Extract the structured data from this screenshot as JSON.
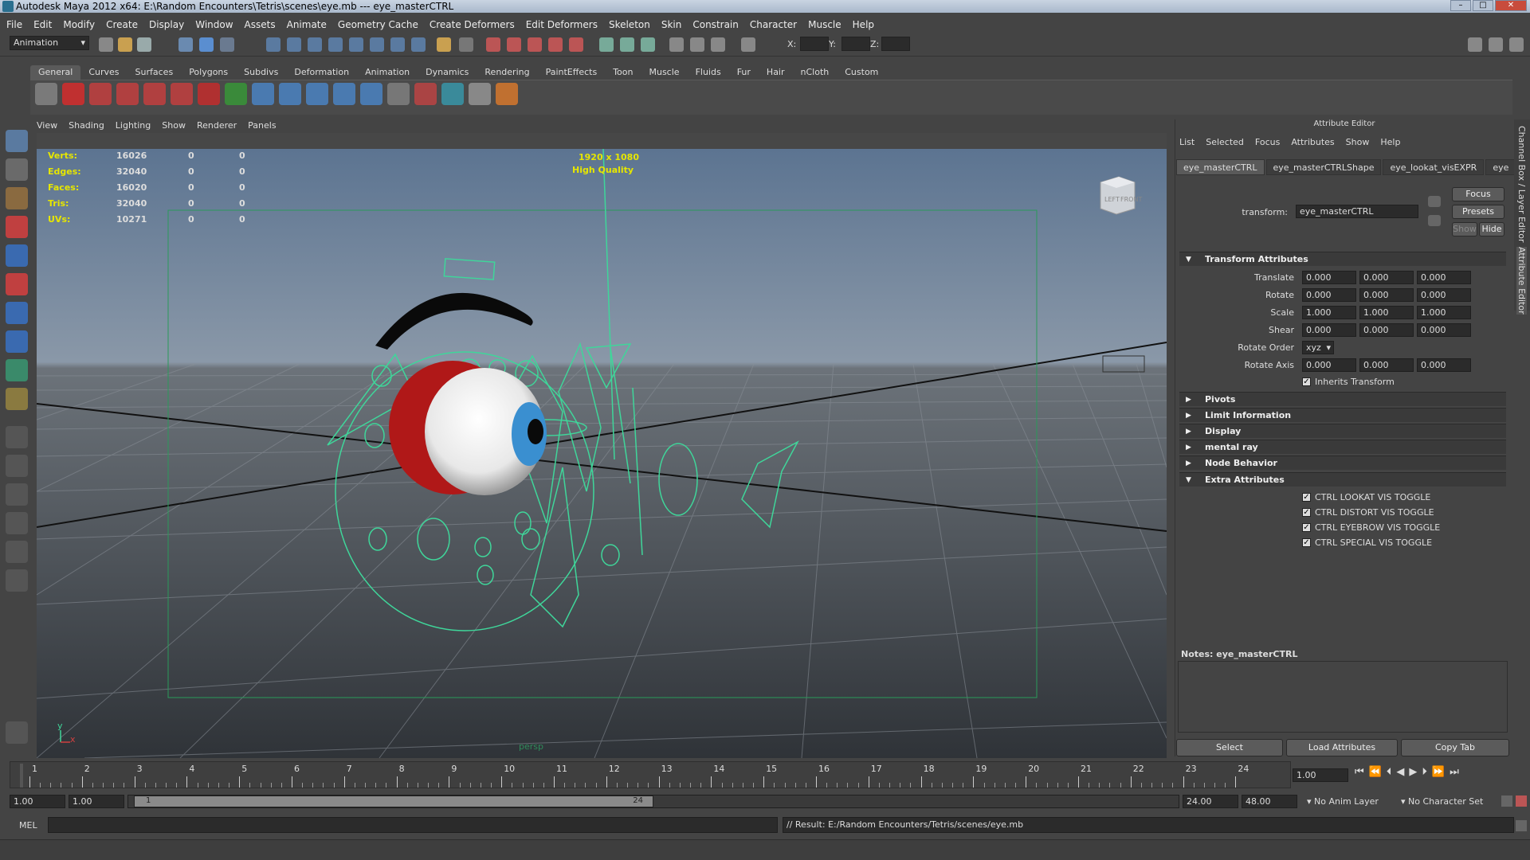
{
  "window": {
    "title": "Autodesk Maya 2012 x64: E:\\Random Encounters\\Tetris\\scenes\\eye.mb   ---   eye_masterCTRL"
  },
  "menubar": [
    "File",
    "Edit",
    "Modify",
    "Create",
    "Display",
    "Window",
    "Assets",
    "Animate",
    "Geometry Cache",
    "Create Deformers",
    "Edit Deformers",
    "Skeleton",
    "Skin",
    "Constrain",
    "Character",
    "Muscle",
    "Help"
  ],
  "toolbar": {
    "mode": "Animation",
    "x_label": "X:",
    "y_label": "Y:",
    "z_label": "Z:"
  },
  "shelf_tabs": [
    "General",
    "Curves",
    "Surfaces",
    "Polygons",
    "Subdivs",
    "Deformation",
    "Animation",
    "Dynamics",
    "Rendering",
    "PaintEffects",
    "Toon",
    "Muscle",
    "Fluids",
    "Fur",
    "Hair",
    "nCloth",
    "Custom"
  ],
  "viewport": {
    "menu": [
      "View",
      "Shading",
      "Lighting",
      "Show",
      "Renderer",
      "Panels"
    ],
    "hud": [
      {
        "label": "Verts:",
        "values": [
          "16026",
          "0",
          "0"
        ]
      },
      {
        "label": "Edges:",
        "values": [
          "32040",
          "0",
          "0"
        ]
      },
      {
        "label": "Faces:",
        "values": [
          "16020",
          "0",
          "0"
        ]
      },
      {
        "label": "Tris:",
        "values": [
          "32040",
          "0",
          "0"
        ]
      },
      {
        "label": "UVs:",
        "values": [
          "10271",
          "0",
          "0"
        ]
      }
    ],
    "resolution": "1920 x 1080",
    "quality": "High Quality",
    "camera": "persp",
    "viewcube_left": "LEFT",
    "viewcube_front": "FRONT",
    "axis_y": "y",
    "axis_x": "x"
  },
  "attribute_editor": {
    "title": "Attribute Editor",
    "menu": [
      "List",
      "Selected",
      "Focus",
      "Attributes",
      "Show",
      "Help"
    ],
    "tabs": [
      "eye_masterCTRL",
      "eye_masterCTRLShape",
      "eye_lookat_visEXPR",
      "eye"
    ],
    "focus_button": "Focus",
    "presets_button": "Presets",
    "show_button": "Show",
    "hide_button": "Hide",
    "transform_label": "transform:",
    "transform_value": "eye_masterCTRL",
    "transform_section": "Transform Attributes",
    "rows": [
      {
        "label": "Translate",
        "values": [
          "0.000",
          "0.000",
          "0.000"
        ]
      },
      {
        "label": "Rotate",
        "values": [
          "0.000",
          "0.000",
          "0.000"
        ]
      },
      {
        "label": "Scale",
        "values": [
          "1.000",
          "1.000",
          "1.000"
        ]
      },
      {
        "label": "Shear",
        "values": [
          "0.000",
          "0.000",
          "0.000"
        ]
      }
    ],
    "rotate_order_label": "Rotate Order",
    "rotate_order_value": "xyz",
    "rotate_axis_label": "Rotate Axis",
    "rotate_axis_values": [
      "0.000",
      "0.000",
      "0.000"
    ],
    "inherits_transform": "Inherits Transform",
    "collapsed_sections": [
      "Pivots",
      "Limit Information",
      "Display",
      "mental ray",
      "Node Behavior"
    ],
    "extra_section": "Extra Attributes",
    "extra_checks": [
      "CTRL LOOKAT VIS TOGGLE",
      "CTRL DISTORT VIS TOGGLE",
      "CTRL EYEBROW VIS TOGGLE",
      "CTRL SPECIAL VIS TOGGLE"
    ],
    "notes_label": "Notes:  eye_masterCTRL",
    "bottom_buttons": [
      "Select",
      "Load Attributes",
      "Copy Tab"
    ],
    "side_tabs": [
      "Channel Box / Layer Editor",
      "Attribute Editor"
    ]
  },
  "timeline": {
    "ticks": [
      "1",
      "2",
      "3",
      "4",
      "5",
      "6",
      "7",
      "8",
      "9",
      "10",
      "11",
      "12",
      "13",
      "14",
      "15",
      "16",
      "17",
      "18",
      "19",
      "20",
      "21",
      "22",
      "23",
      "24"
    ],
    "current_frame": "1.00",
    "range_start": "1.00",
    "range_start2": "1.00",
    "range_slider_start": "1",
    "range_slider_end": "24",
    "range_end": "24.00",
    "range_end2": "48.00",
    "anim_layer": "No Anim Layer",
    "character_set": "No Character Set"
  },
  "command": {
    "mel_label": "MEL",
    "result": "// Result: E:/Random Encounters/Tetris/scenes/eye.mb"
  },
  "colors": {
    "wire_green": "#3fd69a",
    "iris_blue": "#3a8fd0",
    "eyelid_red": "#b01818"
  }
}
